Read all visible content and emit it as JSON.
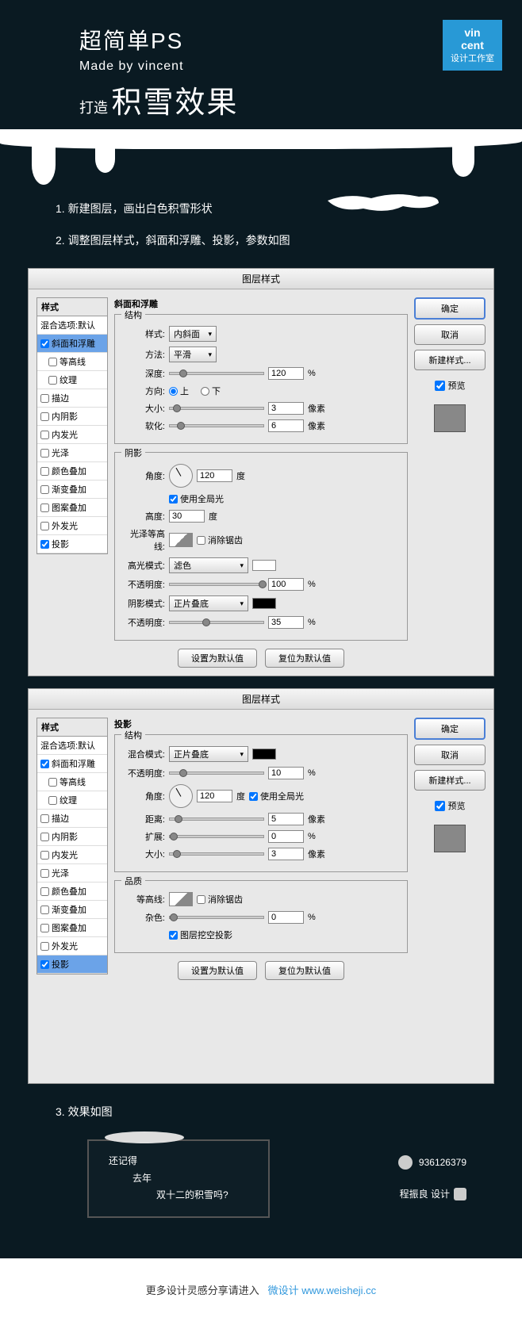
{
  "header": {
    "title1": "超简单PS",
    "subtitle": "Made by vincent",
    "title2": "打造",
    "title3": "积雪效果",
    "logo_l1": "vin",
    "logo_l2": "cent",
    "logo_l3": "设计工作室"
  },
  "steps": {
    "s1": "1. 新建图层，画出白色积雪形状",
    "s2": "2. 调整图层样式，斜面和浮雕、投影，参数如图",
    "s3": "3. 效果如图"
  },
  "dialog_common": {
    "title": "图层样式",
    "sidebar_header": "样式",
    "blend_default": "混合选项:默认",
    "items": {
      "bevel": "斜面和浮雕",
      "contour": "等高线",
      "texture": "纹理",
      "stroke": "描边",
      "inner_shadow": "内阴影",
      "inner_glow": "内发光",
      "satin": "光泽",
      "color_overlay": "颜色叠加",
      "gradient_overlay": "渐变叠加",
      "pattern_overlay": "图案叠加",
      "outer_glow": "外发光",
      "drop_shadow": "投影"
    },
    "ok": "确定",
    "cancel": "取消",
    "new_style": "新建样式...",
    "preview": "预览",
    "set_default": "设置为默认值",
    "reset_default": "复位为默认值"
  },
  "bevel": {
    "section": "斜面和浮雕",
    "structure": "结构",
    "style_label": "样式:",
    "style_val": "内斜面",
    "method_label": "方法:",
    "method_val": "平滑",
    "depth_label": "深度:",
    "depth_val": "120",
    "direction_label": "方向:",
    "dir_up": "上",
    "dir_down": "下",
    "size_label": "大小:",
    "size_val": "3",
    "soften_label": "软化:",
    "soften_val": "6",
    "shading": "阴影",
    "angle_label": "角度:",
    "angle_val": "120",
    "global_light": "使用全局光",
    "altitude_label": "高度:",
    "altitude_val": "30",
    "gloss_label": "光泽等高线:",
    "antialias": "消除锯齿",
    "highlight_label": "高光模式:",
    "highlight_val": "滤色",
    "opacity_label": "不透明度:",
    "hl_opacity_val": "100",
    "shadow_label": "阴影模式:",
    "shadow_val": "正片叠底",
    "sh_opacity_val": "35",
    "percent": "%",
    "px": "像素",
    "deg": "度"
  },
  "drop": {
    "section": "投影",
    "structure": "结构",
    "blend_label": "混合模式:",
    "blend_val": "正片叠底",
    "opacity_label": "不透明度:",
    "opacity_val": "10",
    "angle_label": "角度:",
    "angle_val": "120",
    "global_light": "使用全局光",
    "distance_label": "距离:",
    "distance_val": "5",
    "spread_label": "扩展:",
    "spread_val": "0",
    "size_label": "大小:",
    "size_val": "3",
    "quality": "品质",
    "contour_label": "等高线:",
    "antialias": "消除锯齿",
    "noise_label": "杂色:",
    "noise_val": "0",
    "knockout": "图层挖空投影",
    "percent": "%",
    "px": "像素",
    "deg": "度"
  },
  "result": {
    "l1": "还记得",
    "l2": "去年",
    "l3": "双十二的积雪吗?",
    "qq": "936126379",
    "designer": "程振良 设计"
  },
  "footer": {
    "text": "更多设计灵感分享请进入",
    "link_text": "微设计 www.weisheji.cc"
  }
}
